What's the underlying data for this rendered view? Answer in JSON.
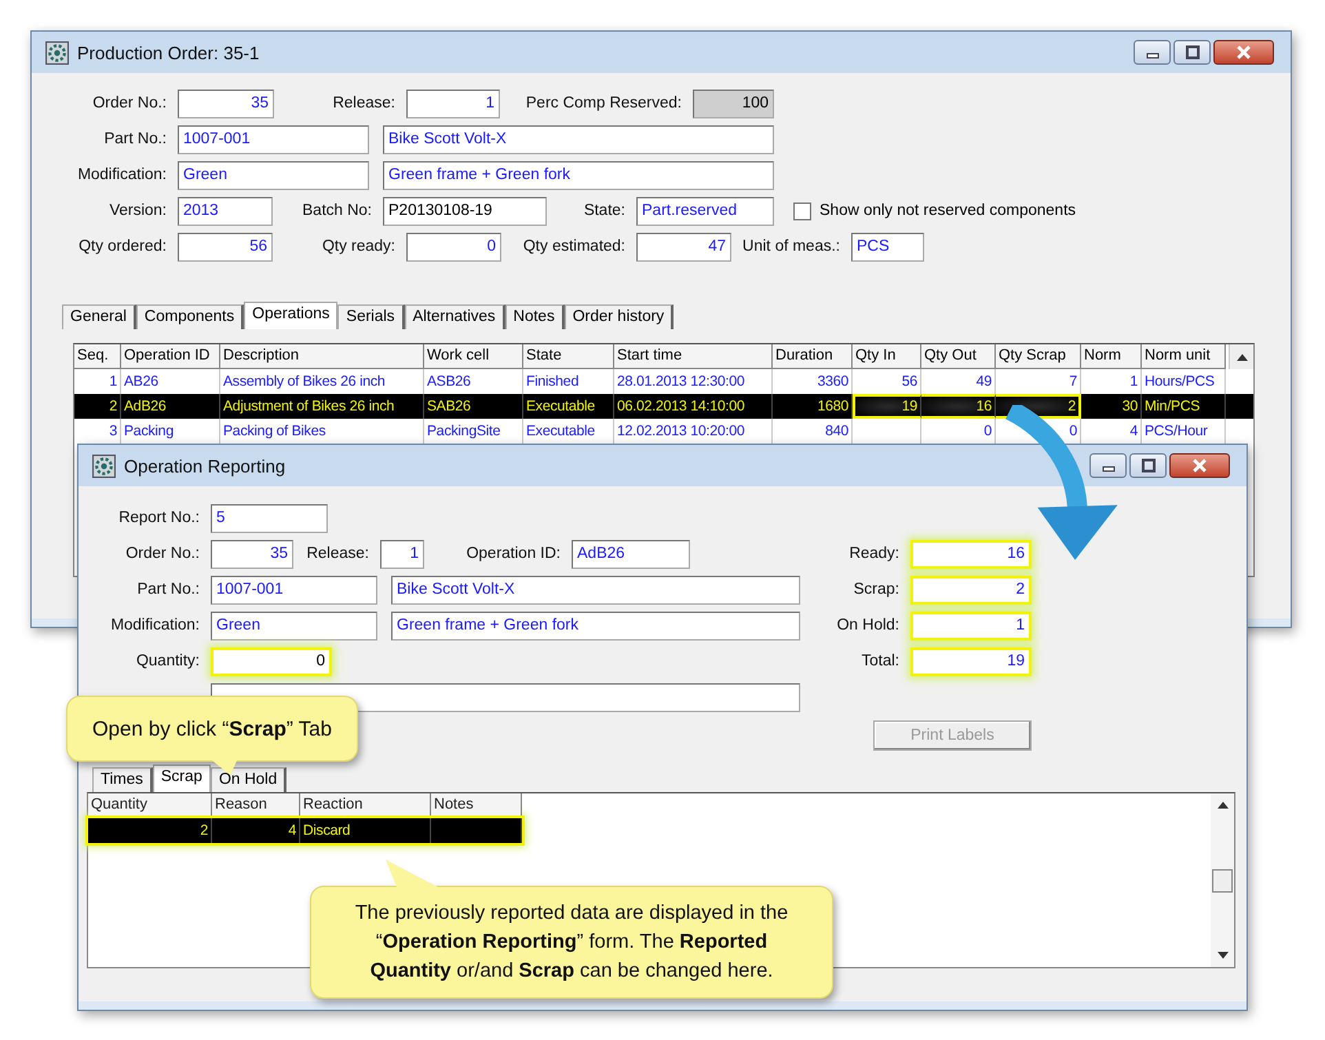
{
  "production_order": {
    "title": "Production Order: 35-1",
    "rows": [
      [
        {
          "kind": "label",
          "text": "Order No.:"
        },
        {
          "kind": "field",
          "value": "35"
        },
        {
          "kind": "label",
          "text": "Release:"
        },
        {
          "kind": "field",
          "value": "1"
        },
        {
          "kind": "label",
          "text": "Perc Comp Reserved:"
        },
        {
          "kind": "readonly-field",
          "value": "100"
        }
      ],
      [
        {
          "kind": "label",
          "text": "Part No.:"
        },
        {
          "kind": "field",
          "value": "1007-001"
        },
        {
          "kind": "field",
          "value": "Bike Scott Volt-X"
        }
      ],
      [
        {
          "kind": "label",
          "text": "Modification:"
        },
        {
          "kind": "field",
          "value": "Green"
        },
        {
          "kind": "field",
          "value": "Green frame + Green fork"
        }
      ],
      [
        {
          "kind": "label",
          "text": "Version:"
        },
        {
          "kind": "field",
          "value": "2013"
        },
        {
          "kind": "label",
          "text": "Batch No:"
        },
        {
          "kind": "text-field",
          "value": "P20130108-19"
        },
        {
          "kind": "label",
          "text": "State:"
        },
        {
          "kind": "field",
          "value": "Part.reserved"
        },
        {
          "kind": "checkbox",
          "label": "Show only not reserved components",
          "checked": false
        }
      ],
      [
        {
          "kind": "label",
          "text": "Qty ordered:"
        },
        {
          "kind": "field",
          "value": "56"
        },
        {
          "kind": "label",
          "text": "Qty ready:"
        },
        {
          "kind": "field",
          "value": "0"
        },
        {
          "kind": "label",
          "text": "Qty estimated:"
        },
        {
          "kind": "field",
          "value": "47"
        },
        {
          "kind": "label",
          "text": "Unit of meas.:"
        },
        {
          "kind": "field",
          "value": "PCS"
        }
      ]
    ],
    "tabs": [
      {
        "label": "General",
        "selected": false
      },
      {
        "label": "Components",
        "selected": false
      },
      {
        "label": "Operations",
        "selected": true
      },
      {
        "label": "Serials",
        "selected": false
      },
      {
        "label": "Alternatives",
        "selected": false
      },
      {
        "label": "Notes",
        "selected": false
      },
      {
        "label": "Order history",
        "selected": false
      }
    ],
    "table": {
      "columns": [
        "Seq.",
        "Operation ID",
        "Description",
        "Work cell",
        "State",
        "Start time",
        "Duration",
        "Qty In",
        "Qty Out",
        "Qty Scrap",
        "Norm",
        "Norm unit"
      ],
      "rows": [
        {
          "selected": false,
          "cells": [
            "1",
            "AB26",
            "Assembly of Bikes 26 inch",
            "ASB26",
            "Finished",
            "28.01.2013 12:30:00",
            "3360",
            "56",
            "49",
            "7",
            "1",
            "Hours/PCS"
          ],
          "highlight": [
            false,
            false,
            false,
            false,
            false,
            false,
            false,
            false,
            false,
            false,
            false,
            false
          ]
        },
        {
          "selected": true,
          "cells": [
            "2",
            "AdB26",
            "Adjustment of Bikes 26 inch",
            "SAB26",
            "Executable",
            "06.02.2013 14:10:00",
            "1680",
            "19",
            "16",
            "2",
            "30",
            "Min/PCS"
          ],
          "highlight": [
            false,
            false,
            false,
            false,
            false,
            false,
            false,
            true,
            true,
            true,
            false,
            false
          ]
        },
        {
          "selected": false,
          "cells": [
            "3",
            "Packing",
            "Packing of Bikes",
            "PackingSite",
            "Executable",
            "12.02.2013 10:20:00",
            "840",
            null,
            "0",
            "0",
            "4",
            "PCS/Hour"
          ],
          "highlight": [
            false,
            false,
            false,
            false,
            false,
            false,
            false,
            false,
            false,
            false,
            false,
            false
          ]
        }
      ]
    }
  },
  "operation_reporting": {
    "title": "Operation Reporting",
    "rows": [
      [
        {
          "kind": "label",
          "text": "Report No.:"
        },
        {
          "kind": "field",
          "value": "5"
        }
      ],
      [
        {
          "kind": "label",
          "text": "Order No.:"
        },
        {
          "kind": "field",
          "value": "35"
        },
        {
          "kind": "label",
          "text": "Release:"
        },
        {
          "kind": "field",
          "value": "1"
        },
        {
          "kind": "label",
          "text": "Operation ID:"
        },
        {
          "kind": "field",
          "value": "AdB26"
        }
      ],
      [
        {
          "kind": "label",
          "text": "Part No.:"
        },
        {
          "kind": "field",
          "value": "1007-001"
        },
        {
          "kind": "field",
          "value": "Bike Scott Volt-X"
        }
      ],
      [
        {
          "kind": "label",
          "text": "Modification:"
        },
        {
          "kind": "field",
          "value": "Green"
        },
        {
          "kind": "field",
          "value": "Green frame + Green fork"
        }
      ],
      [
        {
          "kind": "label",
          "text": "Quantity:"
        },
        {
          "kind": "text-field",
          "value": "0",
          "highlighted": true
        }
      ],
      [
        {
          "kind": "field"
        }
      ]
    ],
    "totals": [
      {
        "label": "Ready:",
        "value": "16",
        "highlighted": true
      },
      {
        "label": "Scrap:",
        "value": "2",
        "highlighted": true
      },
      {
        "label": "On Hold:",
        "value": "1",
        "highlighted": true
      },
      {
        "label": "Total:",
        "value": "19",
        "highlighted": true
      }
    ],
    "print_button": {
      "label": "Print Labels",
      "disabled": true
    },
    "tabs": [
      {
        "label": "Times",
        "selected": false
      },
      {
        "label": "Scrap",
        "selected": true
      },
      {
        "label": "On Hold",
        "selected": false
      }
    ],
    "grid": {
      "columns": [
        "Quantity",
        "Reason",
        "Reaction",
        "Notes"
      ],
      "rows": [
        {
          "cells": [
            "2",
            "4",
            "Discard",
            null
          ],
          "highlighted": true
        }
      ]
    }
  },
  "callouts": [
    {
      "text": "Open by click “**Scrap**” Tab"
    },
    {
      "text": "The previously reported data are displayed in the “**Operation Reporting**” form. The **Reported Quantity** or/and **Scrap** can be changed here."
    }
  ]
}
